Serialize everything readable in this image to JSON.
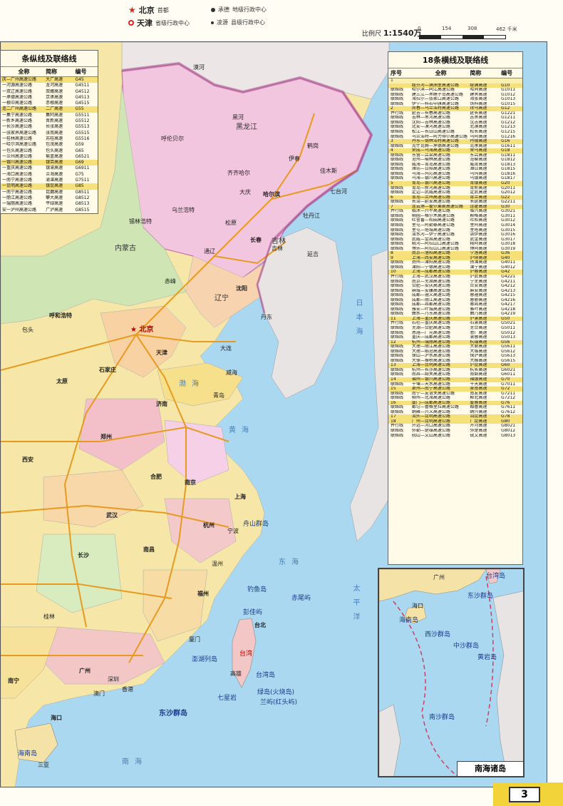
{
  "legend": {
    "capital": {
      "name": "北京",
      "desc": "首都"
    },
    "provincial": {
      "name": "天津",
      "desc": "省级行政中心"
    },
    "prefecture": {
      "name": "承德",
      "desc": "地级行政中心"
    },
    "county": {
      "name": "凌源",
      "desc": "县级行政中心"
    },
    "scale_label": "比例尺",
    "scale_value": "1:1540万",
    "scale_ticks": [
      "0",
      "154",
      "308",
      "462 千米"
    ]
  },
  "left_panel": {
    "title": "条纵线及联络线",
    "headers": [
      "全称",
      "简称",
      "编号"
    ],
    "rows": [
      {
        "full": "庆—广州高速公路",
        "short": "大广高速",
        "code": "G45",
        "hl": true
      },
      {
        "full": "一河源高速公路",
        "short": "龙河高速",
        "code": "G4511",
        "hl": false
      },
      {
        "full": "一双辽高速公路",
        "short": "双嫩高速",
        "code": "G4512",
        "hl": false
      },
      {
        "full": "一承德高速公路",
        "short": "京承高速",
        "code": "G4513",
        "hl": false
      },
      {
        "full": "一根中高速公路",
        "short": "赤根高速",
        "code": "G4515",
        "hl": false
      },
      {
        "full": "连二广州高速公路",
        "short": "二广高速",
        "code": "G55",
        "hl": true
      },
      {
        "full": "一集宁高速公路",
        "short": "集阿高速",
        "code": "G5511",
        "hl": false
      },
      {
        "full": "一新乡高速公路",
        "short": "晋新高速",
        "code": "G5512",
        "hl": false
      },
      {
        "full": "一长沙高速公路",
        "short": "长张高速",
        "code": "G5513",
        "hl": false
      },
      {
        "full": "一张家界高速公路",
        "short": "张南高速",
        "code": "G5515",
        "hl": false
      },
      {
        "full": "一桂林高速公路",
        "short": "苏桂高速",
        "code": "G5516",
        "hl": false
      },
      {
        "full": "一哈尔滨高速公路",
        "short": "包茂高速",
        "code": "G59",
        "hl": false
      },
      {
        "full": "一包头高速公路",
        "short": "包头高速",
        "code": "G65",
        "hl": false
      },
      {
        "full": "一兰州高速公路",
        "short": "榆蓝高速",
        "code": "G6521",
        "hl": false
      },
      {
        "full": "一银川高速公路",
        "short": "银百高速",
        "code": "G69",
        "hl": true
      },
      {
        "full": "一重庆高速公路",
        "short": "银渝高速",
        "code": "G6911",
        "hl": false
      },
      {
        "full": "一海口高速公路",
        "short": "兰海高速",
        "code": "G75",
        "hl": false
      },
      {
        "full": "一南宁高速公路",
        "short": "渝湛高速",
        "code": "G7511",
        "hl": false
      },
      {
        "full": "一昆明高速公路",
        "short": "银昆高速",
        "code": "G85",
        "hl": true
      },
      {
        "full": "一南宁高速公路",
        "short": "昆磨高速",
        "code": "G8511",
        "hl": false
      },
      {
        "full": "一丽江高速公路",
        "short": "攀大高速",
        "code": "G8512",
        "hl": false
      },
      {
        "full": "一瑞丽高速公路",
        "short": "平绿高速",
        "code": "G8513",
        "hl": false
      },
      {
        "full": "安一泸州高速公路",
        "short": "广泸高速",
        "code": "G8515",
        "hl": false
      }
    ]
  },
  "right_panel": {
    "title": "18条横线及联络线",
    "headers": [
      "序号",
      "全称",
      "简称",
      "编号"
    ],
    "rows": [
      {
        "no": "1",
        "full": "",
        "short": "",
        "code": "",
        "type": "num"
      },
      {
        "no": "",
        "full": "绥芬河—满洲里高速公路",
        "short": "绥满高速",
        "code": "G10",
        "type": "hl"
      },
      {
        "no": "联络线",
        "full": "哈尔滨—同江高速公路",
        "short": "哈同高速",
        "code": "G1011",
        "type": ""
      },
      {
        "no": "联络线",
        "full": "建三江—黑瞎子岛高速公路",
        "short": "建黑高速",
        "code": "G1012",
        "type": ""
      },
      {
        "no": "联络线",
        "full": "海拉尔—张家口高速公路",
        "short": "海张高速",
        "code": "G1013",
        "type": ""
      },
      {
        "no": "联络线",
        "full": "伊宁—科右中旗高速公路",
        "short": "铁科高速",
        "code": "G1015",
        "type": ""
      },
      {
        "no": "2",
        "full": "珲春—乌兰浩特高速公路",
        "short": "珲乌高速",
        "code": "G12",
        "type": "hl"
      },
      {
        "no": "并行线",
        "full": "延吉—长春高速公路",
        "short": "延长高速",
        "code": "G1221",
        "type": ""
      },
      {
        "no": "联络线",
        "full": "吉林—黑河高速公路",
        "short": "吉黑高速",
        "code": "G1211",
        "type": ""
      },
      {
        "no": "联络线",
        "full": "沈阳—吉林高速公路",
        "short": "沈吉高速",
        "code": "G1212",
        "type": ""
      },
      {
        "no": "联络线",
        "full": "北安—漠河高速公路",
        "short": "北漠高速",
        "code": "G1213",
        "type": ""
      },
      {
        "no": "联络线",
        "full": "松江—长白山高速公路",
        "short": "松长高速",
        "code": "G1215",
        "type": ""
      },
      {
        "no": "联络线",
        "full": "乌兰浩特—阿力得尔高速公路",
        "short": "乌阿高速",
        "code": "G1216",
        "type": ""
      },
      {
        "no": "3",
        "full": "丹东—锡林浩特高速公路",
        "short": "丹锡高速",
        "code": "G16",
        "type": "hl"
      },
      {
        "no": "联络线",
        "full": "克什克腾—承德高速公路",
        "short": "克承高速",
        "code": "G1611",
        "type": ""
      },
      {
        "no": "4",
        "full": "荣成—乌海高速公路",
        "short": "荣乌高速",
        "code": "G18",
        "type": "hl"
      },
      {
        "no": "联络线",
        "full": "东营—吕梁高速公路",
        "short": "东吕高速",
        "code": "G1811",
        "type": ""
      },
      {
        "no": "联络线",
        "full": "沧州—榆林高速公路",
        "short": "沧榆高速",
        "code": "G1812",
        "type": ""
      },
      {
        "no": "联络线",
        "full": "威海—青岛高速公路",
        "short": "威青高速",
        "code": "G1813",
        "type": ""
      },
      {
        "no": "联络线",
        "full": "潍坊—日照高速公路",
        "short": "潍日高速",
        "code": "G1815",
        "type": ""
      },
      {
        "no": "联络线",
        "full": "乌海—玛沁高速公路",
        "short": "乌玛高速",
        "code": "G1816",
        "type": ""
      },
      {
        "no": "联络线",
        "full": "乌海—银川高速公路",
        "short": "乌银高速",
        "code": "G1817",
        "type": ""
      },
      {
        "no": "5",
        "full": "青岛—银川高速公路",
        "short": "青银高速",
        "code": "G20",
        "type": "hl"
      },
      {
        "no": "联络线",
        "full": "青岛—新河高速公路",
        "short": "青新高速",
        "code": "G2011",
        "type": ""
      },
      {
        "no": "联络线",
        "full": "定边—武威高速公路",
        "short": "定武高速",
        "code": "G2012",
        "type": ""
      },
      {
        "no": "6",
        "full": "青岛—兰州高速公路",
        "short": "青兰高速",
        "code": "G22",
        "type": "hl"
      },
      {
        "no": "联络线",
        "full": "长治—延安高速公路",
        "short": "长延高速",
        "code": "G2211",
        "type": ""
      },
      {
        "no": "7",
        "full": "连云港—霍尔果斯高速公路",
        "short": "连霍高速",
        "code": "G30",
        "type": "hl"
      },
      {
        "no": "并行线",
        "full": "临沭—兴平高速公路",
        "short": "临兴高速",
        "code": "G3021",
        "type": ""
      },
      {
        "no": "联络线",
        "full": "柳园—格尔木高速公路",
        "short": "柳格高速",
        "code": "G3011",
        "type": ""
      },
      {
        "no": "联络线",
        "full": "吐鲁番—和田高速公路",
        "short": "吐和高速",
        "code": "G3012",
        "type": ""
      },
      {
        "no": "联络线",
        "full": "奎屯—阿勒泰高速公路",
        "short": "奎阿高速",
        "code": "G3014",
        "type": ""
      },
      {
        "no": "联络线",
        "full": "奎屯—塔城高速公路",
        "short": "奎塔高速",
        "code": "G3015",
        "type": ""
      },
      {
        "no": "联络线",
        "full": "清水河—伊宁高速公路",
        "short": "清伊高速",
        "code": "G3016",
        "type": ""
      },
      {
        "no": "联络线",
        "full": "武威—金昌高速公路",
        "short": "武金高速",
        "code": "G3017",
        "type": ""
      },
      {
        "no": "联络线",
        "full": "精河—阿拉山口高速公路",
        "short": "精阿高速",
        "code": "G3018",
        "type": ""
      },
      {
        "no": "联络线",
        "full": "博乐—阿拉山口高速公路",
        "short": "博阿高速",
        "code": "G3019",
        "type": ""
      },
      {
        "no": "8",
        "full": "南京—洛阳高速公路",
        "short": "宁洛高速",
        "code": "G36",
        "type": "hl"
      },
      {
        "no": "9",
        "full": "上海—西安高速公路",
        "short": "沪陕高速",
        "code": "G40",
        "type": "hl"
      },
      {
        "no": "联络线",
        "full": "扬州—溧阳高速公路",
        "short": "扬溧高速",
        "code": "G4011",
        "type": ""
      },
      {
        "no": "联络线",
        "full": "溧阳—宁德高速公路",
        "short": "溧宁高速",
        "code": "G4012",
        "type": ""
      },
      {
        "no": "10",
        "full": "上海—成都高速公路",
        "short": "沪蓉高速",
        "code": "G42",
        "type": "hl"
      },
      {
        "no": "并行线",
        "full": "上海—武汉高速公路",
        "short": "沪武高速",
        "code": "G4221",
        "type": ""
      },
      {
        "no": "联络线",
        "full": "南京—芜湖高速公路",
        "short": "宁芜高速",
        "code": "G4211",
        "type": ""
      },
      {
        "no": "联络线",
        "full": "合肥—安庆高速公路",
        "short": "合安高速",
        "code": "G4212",
        "type": ""
      },
      {
        "no": "联络线",
        "full": "麻城—安康高速公路",
        "short": "麻安高速",
        "code": "G4213",
        "type": ""
      },
      {
        "no": "联络线",
        "full": "成都—遵义高速公路",
        "short": "蓉遵高速",
        "code": "G4215",
        "type": ""
      },
      {
        "no": "联络线",
        "full": "成都—丽江高速公路",
        "short": "蓉丽高速",
        "code": "G4216",
        "type": ""
      },
      {
        "no": "联络线",
        "full": "成都—昌都高速公路",
        "short": "蓉昌高速",
        "code": "G4217",
        "type": ""
      },
      {
        "no": "联络线",
        "full": "雅安—叶城高速公路",
        "short": "雅叶高速",
        "code": "G4218",
        "type": ""
      },
      {
        "no": "联络线",
        "full": "曲水—乃东高速公路",
        "short": "曲乃高速",
        "code": "G4219",
        "type": ""
      },
      {
        "no": "11",
        "full": "上海—重庆高速公路",
        "short": "沪渝高速",
        "code": "G50",
        "type": "hl"
      },
      {
        "no": "并行线",
        "full": "石柱—重庆高速公路",
        "short": "石渝高速",
        "code": "G5021",
        "type": ""
      },
      {
        "no": "联络线",
        "full": "芜湖—合肥高速公路",
        "short": "芜合高速",
        "code": "G5011",
        "type": ""
      },
      {
        "no": "联络线",
        "full": "恩施—广元高速公路",
        "short": "恩广高速",
        "code": "G5012",
        "type": ""
      },
      {
        "no": "联络线",
        "full": "重庆—成都高速公路",
        "short": "渝蓉高速",
        "code": "G5013",
        "type": ""
      },
      {
        "no": "12",
        "full": "杭州—瑞丽高速公路",
        "short": "杭瑞高速",
        "code": "G56",
        "type": "hl"
      },
      {
        "no": "联络线",
        "full": "大理—丽江高速公路",
        "short": "大丽高速",
        "code": "G5611",
        "type": ""
      },
      {
        "no": "联络线",
        "full": "大理—临沧高速公路",
        "short": "大临高速",
        "code": "G5612",
        "type": ""
      },
      {
        "no": "联络线",
        "full": "保山—泸水高速公路",
        "short": "保泸高速",
        "code": "G5613",
        "type": ""
      },
      {
        "no": "联络线",
        "full": "大保—猴桥高速公路",
        "short": "大猴高速",
        "code": "G5615",
        "type": ""
      },
      {
        "no": "13",
        "full": "上海—昆明高速公路",
        "short": "沪昆高速",
        "code": "G60",
        "type": "hl"
      },
      {
        "no": "联络线",
        "full": "杭州—长沙高速公路",
        "short": "杭长高速",
        "code": "G6021",
        "type": ""
      },
      {
        "no": "联络线",
        "full": "南昌—韶关高速公路",
        "short": "南韶高速",
        "code": "G6011",
        "type": ""
      },
      {
        "no": "14",
        "full": "福州—银川高速公路",
        "short": "福银高速",
        "code": "G70",
        "type": "hl"
      },
      {
        "no": "联络线",
        "full": "十堰—天水高速公路",
        "short": "十天高速",
        "code": "G7011",
        "type": ""
      },
      {
        "no": "15",
        "full": "泉州—南宁高速公路",
        "short": "泉南高速",
        "code": "G72",
        "type": "hl"
      },
      {
        "no": "联络线",
        "full": "南宁—友谊关高速公路",
        "short": "南友高速",
        "code": "G7211",
        "type": ""
      },
      {
        "no": "联络线",
        "full": "柳州—北海高速公路",
        "short": "柳北高速",
        "code": "G7212",
        "type": ""
      },
      {
        "no": "16",
        "full": "厦门—成都高速公路",
        "short": "厦蓉高速",
        "code": "G76",
        "type": "hl"
      },
      {
        "no": "联络线",
        "full": "都匀—香格里拉高速公路",
        "short": "都香高速",
        "code": "G7611",
        "type": ""
      },
      {
        "no": "联络线",
        "full": "纳雍—兴义高速公路",
        "short": "纳兴高速",
        "code": "G7612",
        "type": ""
      },
      {
        "no": "17",
        "full": "汕头—昆明高速公路",
        "short": "汕昆高速",
        "code": "G78",
        "type": "hl"
      },
      {
        "no": "18",
        "full": "广州—昆明高速公路",
        "short": "广昆高速",
        "code": "G80",
        "type": "hl"
      },
      {
        "no": "并行线",
        "full": "开远—河口高速公路",
        "short": "开河高速",
        "code": "G8021",
        "type": ""
      },
      {
        "no": "联络线",
        "full": "弥勒—楚雄高速公路",
        "short": "弥楚高速",
        "code": "G8012",
        "type": ""
      },
      {
        "no": "联络线",
        "full": "砚山—文山高速公路",
        "short": "砚文高速",
        "code": "G8013",
        "type": ""
      }
    ]
  },
  "map": {
    "capital_label": "北京",
    "cities": [
      {
        "name": "漠河"
      },
      {
        "name": "黑河"
      },
      {
        "name": "呼伦贝尔"
      },
      {
        "name": "齐齐哈尔"
      },
      {
        "name": "伊春"
      },
      {
        "name": "鹤岗"
      },
      {
        "name": "佳木斯"
      },
      {
        "name": "大庆"
      },
      {
        "name": "哈尔滨"
      },
      {
        "name": "七台河"
      },
      {
        "name": "牡丹江"
      },
      {
        "name": "乌兰浩特"
      },
      {
        "name": "松原"
      },
      {
        "name": "长春"
      },
      {
        "name": "吉林"
      },
      {
        "name": "延吉"
      },
      {
        "name": "通辽"
      },
      {
        "name": "赤峰"
      },
      {
        "name": "锡林浩特"
      },
      {
        "name": "沈阳"
      },
      {
        "name": "丹东"
      },
      {
        "name": "大连"
      },
      {
        "name": "呼和浩特"
      },
      {
        "name": "包头"
      },
      {
        "name": "天津"
      },
      {
        "name": "石家庄"
      },
      {
        "name": "太原"
      },
      {
        "name": "济南"
      },
      {
        "name": "青岛"
      },
      {
        "name": "威海"
      },
      {
        "name": "郑州"
      },
      {
        "name": "西安"
      },
      {
        "name": "合肥"
      },
      {
        "name": "南京"
      },
      {
        "name": "上海"
      },
      {
        "name": "武汉"
      },
      {
        "name": "杭州"
      },
      {
        "name": "长沙"
      },
      {
        "name": "南昌"
      },
      {
        "name": "福州"
      },
      {
        "name": "厦门"
      },
      {
        "name": "广州"
      },
      {
        "name": "深圳"
      },
      {
        "name": "香港"
      },
      {
        "name": "澳门"
      },
      {
        "name": "南宁"
      },
      {
        "name": "桂林"
      },
      {
        "name": "海口"
      },
      {
        "name": "三亚"
      },
      {
        "name": "台北"
      },
      {
        "name": "高雄"
      },
      {
        "name": "宁波"
      },
      {
        "name": "温州"
      }
    ],
    "seas": {
      "bohai": "渤海",
      "huanghai": "黄海",
      "donghai": "东海",
      "nanhai": "南海",
      "taipingyang": "太平洋",
      "riben": "日本海"
    },
    "islands": {
      "taiwan": "台湾岛",
      "penghu": "澎湖列岛",
      "diaoyu": "钓鱼岛",
      "chiwei": "赤尾屿",
      "pengjia": "彭佳屿",
      "zhoushan": "舟山群岛",
      "dongsha": "东沙群岛",
      "lvdao": "绿岛(火烧岛)",
      "lanyu": "兰屿(红头屿)",
      "qixingyan": "七星岩",
      "hainan": "海南岛"
    },
    "provinces": {
      "heilongjiang": "黑龙江",
      "jilin": "吉林",
      "neimenggu": "内蒙古",
      "liaoning": "辽宁",
      "taiwan": "台湾"
    }
  },
  "inset": {
    "title": "南海诸岛",
    "labels": {
      "dongsha": "东沙群岛",
      "xisha": "西沙群岛",
      "zhongsha": "中沙群岛",
      "huangyan": "黄岩岛",
      "nansha": "南沙群岛",
      "hainan": "海南岛",
      "taiwan": "台湾岛",
      "guangzhou": "广州",
      "haikou": "海口"
    }
  },
  "page_number": "3"
}
